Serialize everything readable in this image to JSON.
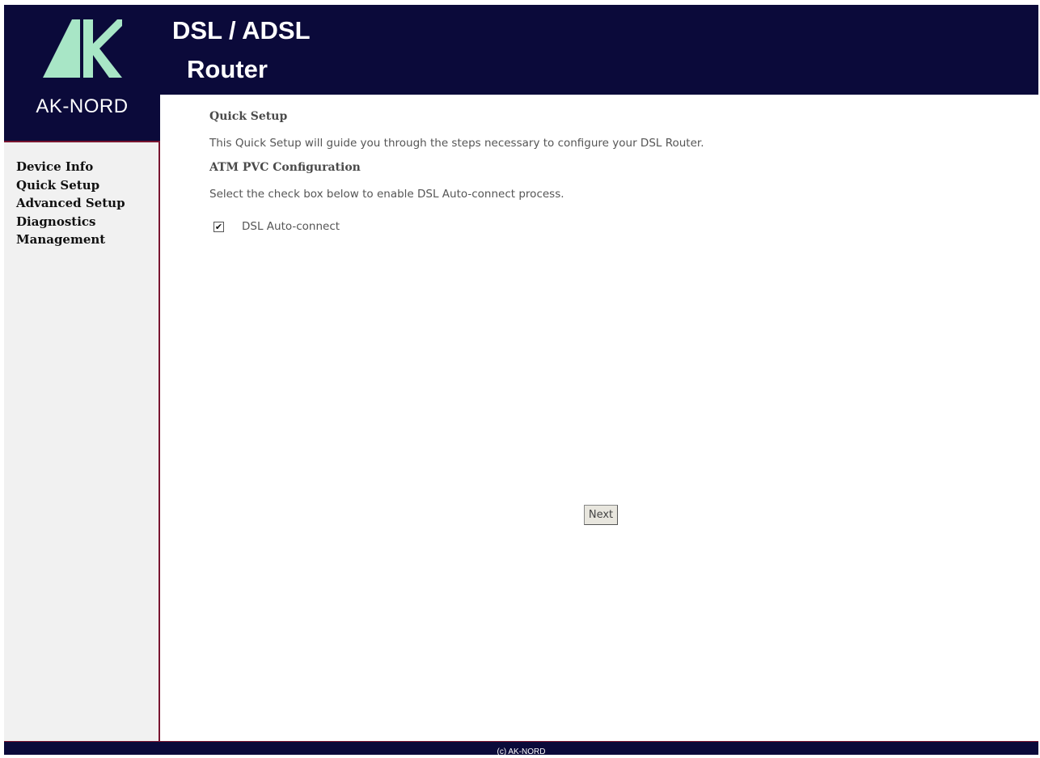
{
  "header": {
    "brand": "AK-NORD",
    "title_line1": "DSL / ADSL",
    "title_line2": "Router",
    "logo_icon": "ak-logo-icon",
    "colors": {
      "header_bg": "#0b0a3a",
      "logo_green": "#a8e6c6",
      "accent": "#7a1530"
    }
  },
  "sidebar": {
    "items": [
      {
        "label": "Device Info"
      },
      {
        "label": "Quick Setup"
      },
      {
        "label": "Advanced Setup"
      },
      {
        "label": "Diagnostics"
      },
      {
        "label": "Management"
      }
    ]
  },
  "main": {
    "title": "Quick Setup",
    "intro": "This Quick Setup will guide you through the steps necessary to configure your DSL Router.",
    "section_title": "ATM PVC Configuration",
    "instruction": "Select the check box below to enable DSL Auto-connect process.",
    "checkbox": {
      "label": "DSL Auto-connect",
      "checked": true,
      "glyph": "✔"
    },
    "next_label": "Next"
  },
  "footer": {
    "text": "(c) AK-NORD"
  }
}
